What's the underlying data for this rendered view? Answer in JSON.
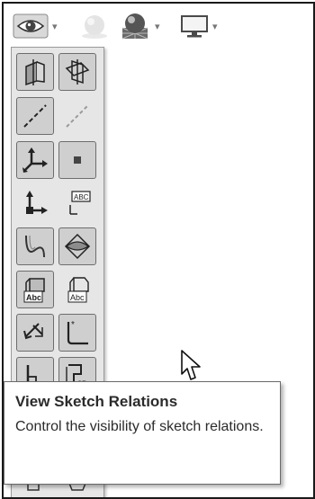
{
  "toolbar": {
    "items": [
      {
        "icon": "eye-icon"
      },
      {
        "icon": "scene-sphere-icon"
      },
      {
        "icon": "appearance-sphere-icon"
      },
      {
        "icon": "monitor-icon"
      }
    ]
  },
  "flyout": {
    "buttons": [
      {
        "icon": "view-planes-icon"
      },
      {
        "icon": "view-all-planes-icon"
      },
      {
        "icon": "view-axes-icon"
      },
      {
        "icon": "view-temporary-axes-icon"
      },
      {
        "icon": "view-coordinate-systems-icon"
      },
      {
        "icon": "view-points-icon"
      },
      {
        "icon": "view-origins-icon"
      },
      {
        "icon": "view-coordinate-dimensions-icon"
      },
      {
        "icon": "view-curves-icon"
      },
      {
        "icon": "view-surfaces-icon"
      },
      {
        "icon": "view-annotations-icon"
      },
      {
        "icon": "view-annotations-alt-icon"
      },
      {
        "icon": "view-dimension-names-icon"
      },
      {
        "icon": "view-sketch-icon"
      },
      {
        "icon": "view-sketch-relations-icon"
      },
      {
        "icon": "view-3d-sketch-icon"
      }
    ]
  },
  "tooltip": {
    "title": "View Sketch Relations",
    "description": "Control the visibility of sketch relations."
  },
  "colors": {
    "panel": "#e6e6e6",
    "button_boxed": "#cfcfcf",
    "icon": "#2a2a2a"
  }
}
